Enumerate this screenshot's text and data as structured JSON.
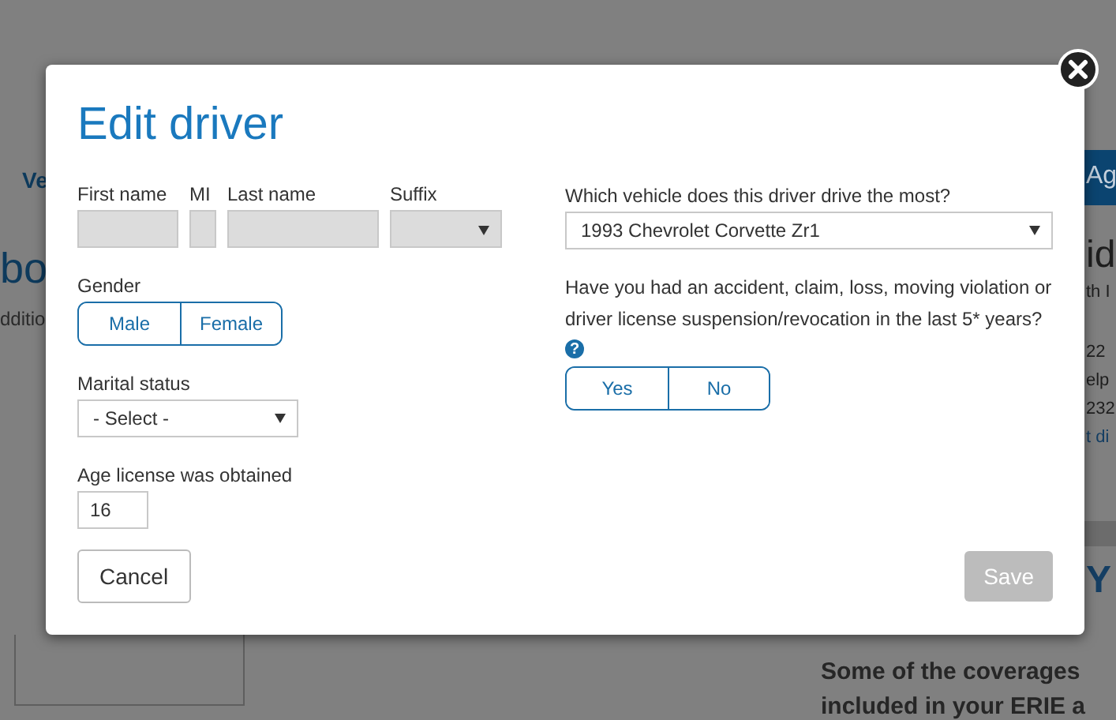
{
  "background": {
    "nav_left": "Ve",
    "nav_right": "Ag",
    "heading": "bo",
    "subtext": "dditio",
    "side_title": "id",
    "side_lines": [
      "th I",
      "22",
      "elp",
      "232"
    ],
    "side_link": "t di",
    "promo_title": "Y",
    "promo_lines": [
      "Some of the coverages",
      "included in your ERIE a"
    ]
  },
  "dialog": {
    "title": "Edit driver",
    "name_fields": [
      {
        "label": "First name",
        "kind": "text"
      },
      {
        "label": "MI",
        "kind": "text"
      },
      {
        "label": "Last name",
        "kind": "text"
      },
      {
        "label": "Suffix",
        "kind": "select"
      }
    ],
    "gender": {
      "label": "Gender",
      "options": [
        {
          "label": "Male",
          "selected": false
        },
        {
          "label": "Female",
          "selected": false
        }
      ]
    },
    "marital_status": {
      "label": "Marital status",
      "value": "- Select -"
    },
    "license_age": {
      "label": "Age license was obtained",
      "value": "16"
    },
    "vehicle": {
      "label": "Which vehicle does this driver drive the most?",
      "value": "1993 Chevrolet Corvette Zr1"
    },
    "incident": {
      "label": "Have you had an accident, claim, loss, moving violation or driver license suspension/revocation in the last 5* years?",
      "help_icon": "?",
      "options": [
        {
          "label": "Yes",
          "selected": false
        },
        {
          "label": "No",
          "selected": false
        }
      ]
    },
    "buttons": [
      {
        "label": "Cancel",
        "disabled": false
      },
      {
        "label": "Save",
        "disabled": true
      }
    ]
  }
}
